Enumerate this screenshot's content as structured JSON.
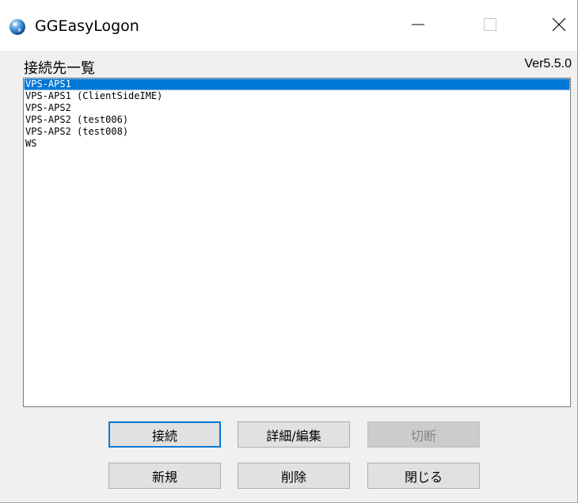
{
  "window": {
    "title": "GGEasyLogon",
    "icons": {
      "app": "globe-icon",
      "minimize": "minimize-icon",
      "maximize": "maximize-icon",
      "close": "close-icon"
    }
  },
  "main": {
    "heading": "接続先一覧",
    "version": "Ver5.5.0",
    "connections": [
      "VPS-APS1",
      "VPS-APS1 (ClientSideIME)",
      "VPS-APS2",
      "VPS-APS2 (test006)",
      "VPS-APS2 (test008)",
      "WS"
    ],
    "selected_index": 0
  },
  "buttons": {
    "connect": "接続",
    "details_edit": "詳細/編集",
    "disconnect": "切断",
    "new": "新規",
    "delete": "削除",
    "close": "閉じる"
  },
  "colors": {
    "selection": "#0078d7",
    "default_button_border": "#0078d7"
  }
}
